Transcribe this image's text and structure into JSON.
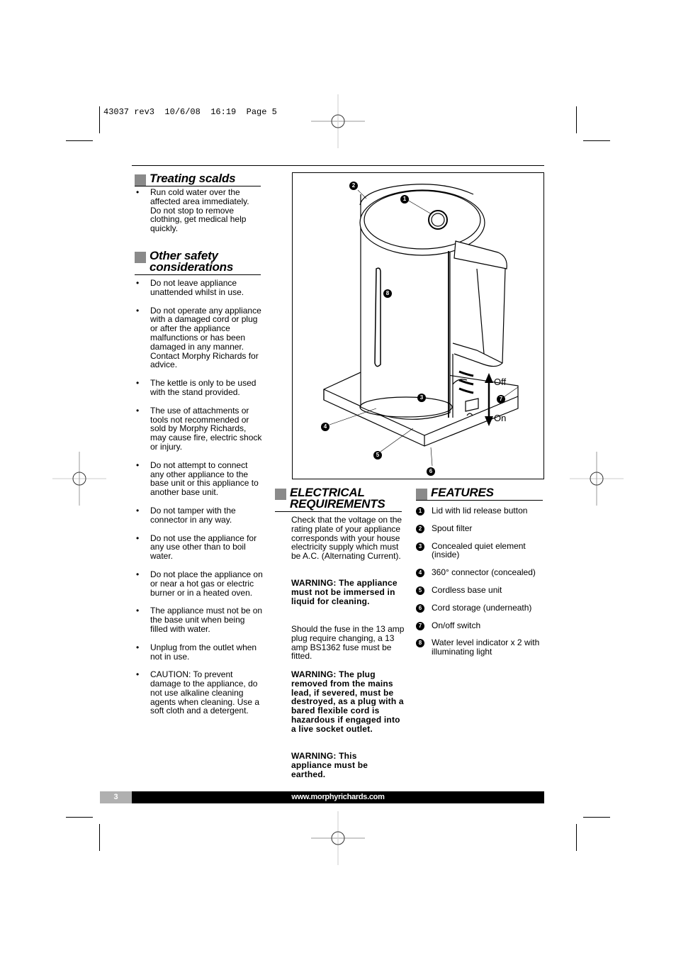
{
  "print_slug": "43037 rev3  10/6/08  16:19  Page 5",
  "colors": {
    "section_square": "#8a8a8a",
    "footer_bar": "#000000",
    "footer_page_box": "#b0b0b0"
  },
  "treating_scalds": {
    "title": "Treating scalds",
    "items": [
      "Run cold water over the affected area immediately. Do not stop to remove clothing, get medical help quickly."
    ]
  },
  "other_safety": {
    "title_line1": "Other safety",
    "title_line2": "considerations",
    "items": [
      "Do not leave appliance unattended whilst in use.",
      "Do not operate any appliance with a damaged cord or plug or after the appliance malfunctions or has been damaged in any manner. Contact Morphy Richards for advice.",
      "The kettle is only to be used with the stand provided.",
      "The use of attachments or tools not recommended or sold by Morphy Richards, may cause fire, electric shock or injury.",
      "Do not attempt to connect any other appliance to the base unit or this appliance to another base unit.",
      "Do not tamper with the connector in any way.",
      "Do not use the appliance for any use other than to boil water.",
      "Do not place the appliance on or near a hot gas or electric burner or in a heated oven.",
      "The appliance must not be on the base unit when being filled with water.",
      "Unplug from the outlet when not in use.",
      "CAUTION: To prevent damage to the appliance, do not use alkaline cleaning agents when cleaning. Use a soft cloth and a detergent."
    ]
  },
  "electrical": {
    "title_line1": "ELECTRICAL",
    "title_line2": "REQUIREMENTS",
    "para1": "Check that the voltage on the rating plate of your appliance corresponds with your house electricity supply which must be A.C. (Alternating Current).",
    "warning1": "WARNING: The appliance must not be immersed in liquid for cleaning.",
    "para2": "Should the fuse in the 13 amp plug require changing, a 13 amp BS1362 fuse must be fitted.",
    "warning2": "WARNING: The plug removed from the mains lead, if severed, must be destroyed, as a plug with a bared flexible cord is hazardous if engaged into a live socket outlet.",
    "warning3": "WARNING: This appliance must be earthed."
  },
  "features": {
    "title": "FEATURES",
    "items": [
      {
        "num": "1",
        "label": "Lid with lid release button"
      },
      {
        "num": "2",
        "label": "Spout filter"
      },
      {
        "num": "3",
        "label": "Concealed quiet element (inside)"
      },
      {
        "num": "4",
        "label": "360° connector (concealed)"
      },
      {
        "num": "5",
        "label": "Cordless base unit"
      },
      {
        "num": "6",
        "label": "Cord storage (underneath)"
      },
      {
        "num": "7",
        "label": "On/off switch"
      },
      {
        "num": "8",
        "label": "Water level indicator x 2 with illuminating light"
      }
    ]
  },
  "figure": {
    "subject": "kettle-diagram",
    "callouts": [
      "1",
      "2",
      "3",
      "4",
      "5",
      "6",
      "7",
      "8"
    ],
    "switch_off_label": "Off",
    "switch_on_label": "On"
  },
  "footer": {
    "page_number": "3",
    "website": "www.morphyrichards.com"
  }
}
